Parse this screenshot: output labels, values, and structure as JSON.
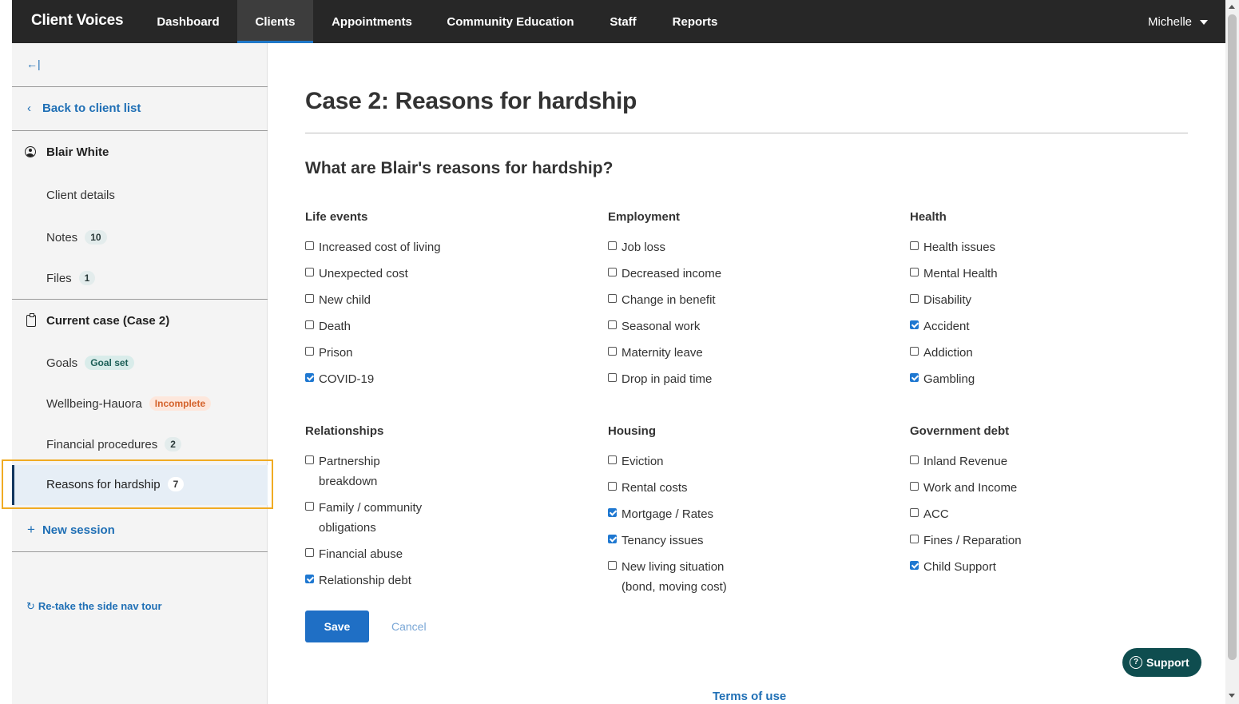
{
  "app": {
    "brand": "Client Voices"
  },
  "nav": {
    "items": [
      "Dashboard",
      "Clients",
      "Appointments",
      "Community Education",
      "Staff",
      "Reports"
    ],
    "active": "Clients",
    "user": "Michelle"
  },
  "sidebar": {
    "collapse_icon": "collapse-left-icon",
    "back": "Back to client list",
    "client_name": "Blair White",
    "client_details": "Client details",
    "notes": {
      "label": "Notes",
      "count": "10"
    },
    "files": {
      "label": "Files",
      "count": "1"
    },
    "current_case": "Current case (Case 2)",
    "goals": {
      "label": "Goals",
      "badge": "Goal set"
    },
    "wellbeing": {
      "label": "Wellbeing-Hauora",
      "badge": "Incomplete"
    },
    "financial": {
      "label": "Financial procedures",
      "count": "2"
    },
    "reasons": {
      "label": "Reasons for hardship",
      "count": "7"
    },
    "new_session": "New session",
    "retake": "Re-take the side nav tour"
  },
  "main": {
    "title": "Case 2: Reasons for hardship",
    "question": "What are Blair's reasons for hardship?",
    "groups": [
      {
        "title": "Life events",
        "options": [
          {
            "label": "Increased cost of living",
            "checked": false
          },
          {
            "label": "Unexpected cost",
            "checked": false
          },
          {
            "label": "New child",
            "checked": false
          },
          {
            "label": "Death",
            "checked": false
          },
          {
            "label": "Prison",
            "checked": false
          },
          {
            "label": "COVID-19",
            "checked": true
          }
        ]
      },
      {
        "title": "Employment",
        "options": [
          {
            "label": "Job loss",
            "checked": false
          },
          {
            "label": "Decreased income",
            "checked": false
          },
          {
            "label": "Change in benefit",
            "checked": false
          },
          {
            "label": "Seasonal work",
            "checked": false
          },
          {
            "label": "Maternity leave",
            "checked": false
          },
          {
            "label": "Drop in paid time",
            "checked": false
          }
        ]
      },
      {
        "title": "Health",
        "options": [
          {
            "label": "Health issues",
            "checked": false
          },
          {
            "label": "Mental Health",
            "checked": false
          },
          {
            "label": "Disability",
            "checked": false
          },
          {
            "label": "Accident",
            "checked": true
          },
          {
            "label": "Addiction",
            "checked": false
          },
          {
            "label": "Gambling",
            "checked": true
          }
        ]
      },
      {
        "title": "Relationships",
        "options": [
          {
            "label": "Partnership breakdown",
            "checked": false
          },
          {
            "label": "Family / community obligations",
            "checked": false
          },
          {
            "label": "Financial abuse",
            "checked": false
          },
          {
            "label": "Relationship debt",
            "checked": true
          }
        ]
      },
      {
        "title": "Housing",
        "options": [
          {
            "label": "Eviction",
            "checked": false
          },
          {
            "label": "Rental costs",
            "checked": false
          },
          {
            "label": "Mortgage / Rates",
            "checked": true
          },
          {
            "label": "Tenancy issues",
            "checked": true
          },
          {
            "label": "New living situation (bond, moving cost)",
            "checked": false
          }
        ]
      },
      {
        "title": "Government debt",
        "options": [
          {
            "label": "Inland Revenue",
            "checked": false
          },
          {
            "label": "Work and Income",
            "checked": false
          },
          {
            "label": "ACC",
            "checked": false
          },
          {
            "label": "Fines / Reparation",
            "checked": false
          },
          {
            "label": "Child Support",
            "checked": true
          }
        ]
      }
    ],
    "save": "Save",
    "cancel": "Cancel"
  },
  "support": "Support",
  "footer": {
    "terms": "Terms of use"
  }
}
